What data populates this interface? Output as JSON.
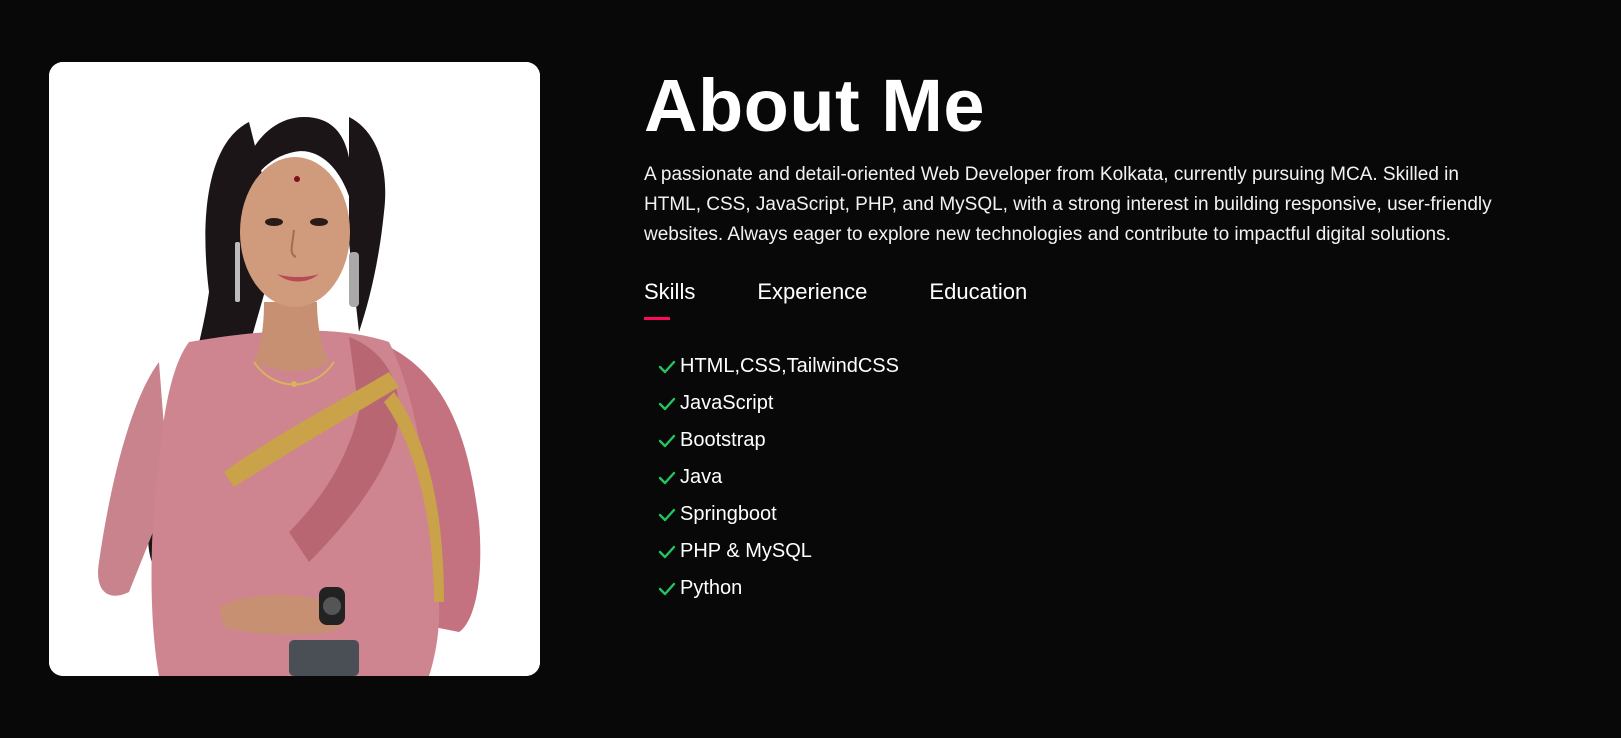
{
  "about": {
    "title": "About Me",
    "bio": "A passionate and detail-oriented Web Developer from Kolkata, currently pursuing MCA. Skilled in HTML, CSS, JavaScript, PHP, and MySQL, with a strong interest in building responsive, user-friendly websites. Always eager to explore new technologies and contribute to impactful digital solutions."
  },
  "tabs": [
    {
      "label": "Skills",
      "active": true
    },
    {
      "label": "Experience",
      "active": false
    },
    {
      "label": "Education",
      "active": false
    }
  ],
  "skills": [
    "HTML,CSS,TailwindCSS",
    "JavaScript",
    "Bootstrap",
    "Java",
    "Springboot",
    "PHP & MySQL",
    "Python"
  ],
  "colors": {
    "background": "#080808",
    "accent": "#ff0a5a",
    "check": "#22c55e",
    "text": "#ffffff"
  },
  "icons": {
    "skill_marker": "check-icon"
  }
}
